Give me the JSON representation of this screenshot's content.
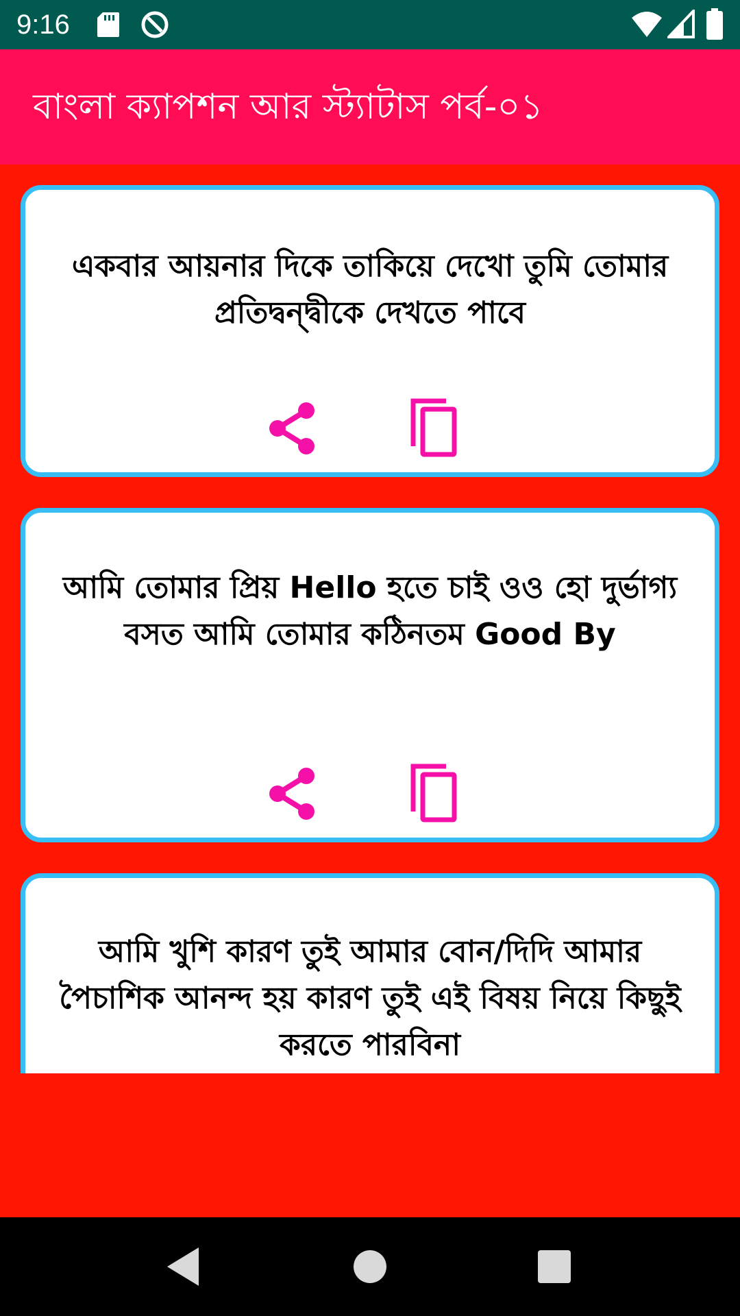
{
  "status_bar": {
    "time": "9:16",
    "icons": [
      "sd-card-icon",
      "data-saver-icon",
      "wifi-icon",
      "signal-icon",
      "battery-icon"
    ]
  },
  "app_bar": {
    "title": "বাংলা ক্যাপশন আর স্ট্যাটাস পর্ব-০১"
  },
  "cards": [
    {
      "text": "একবার আয়নার দিকে তাকিয়ে দেখো তুমি তোমার প্রতিদ্বন্দ্বীকে দেখতে পাবে"
    },
    {
      "text": "আমি তোমার প্রিয় Hello হতে চাই ওও হো দুর্ভাগ্য বসত আমি তোমার কঠিনতম Good By"
    },
    {
      "text": "আমি খুশি কারণ তুই আমার বোন/দিদি আমার পৈচাশিক আনন্দ হয় কারণ তুই এই বিষয় নিয়ে কিছুই করতে পারবিনা"
    }
  ],
  "card_actions": [
    "share-icon",
    "copy-icon"
  ],
  "nav_bar": [
    "back-icon",
    "home-icon",
    "recents-icon"
  ],
  "colors": {
    "status_bar": "#005a4f",
    "app_bar": "#ff0c55",
    "background": "#ff1500",
    "card_border": "#38bdf5",
    "icon_accent": "#f511a8",
    "nav_bar": "#000000"
  }
}
